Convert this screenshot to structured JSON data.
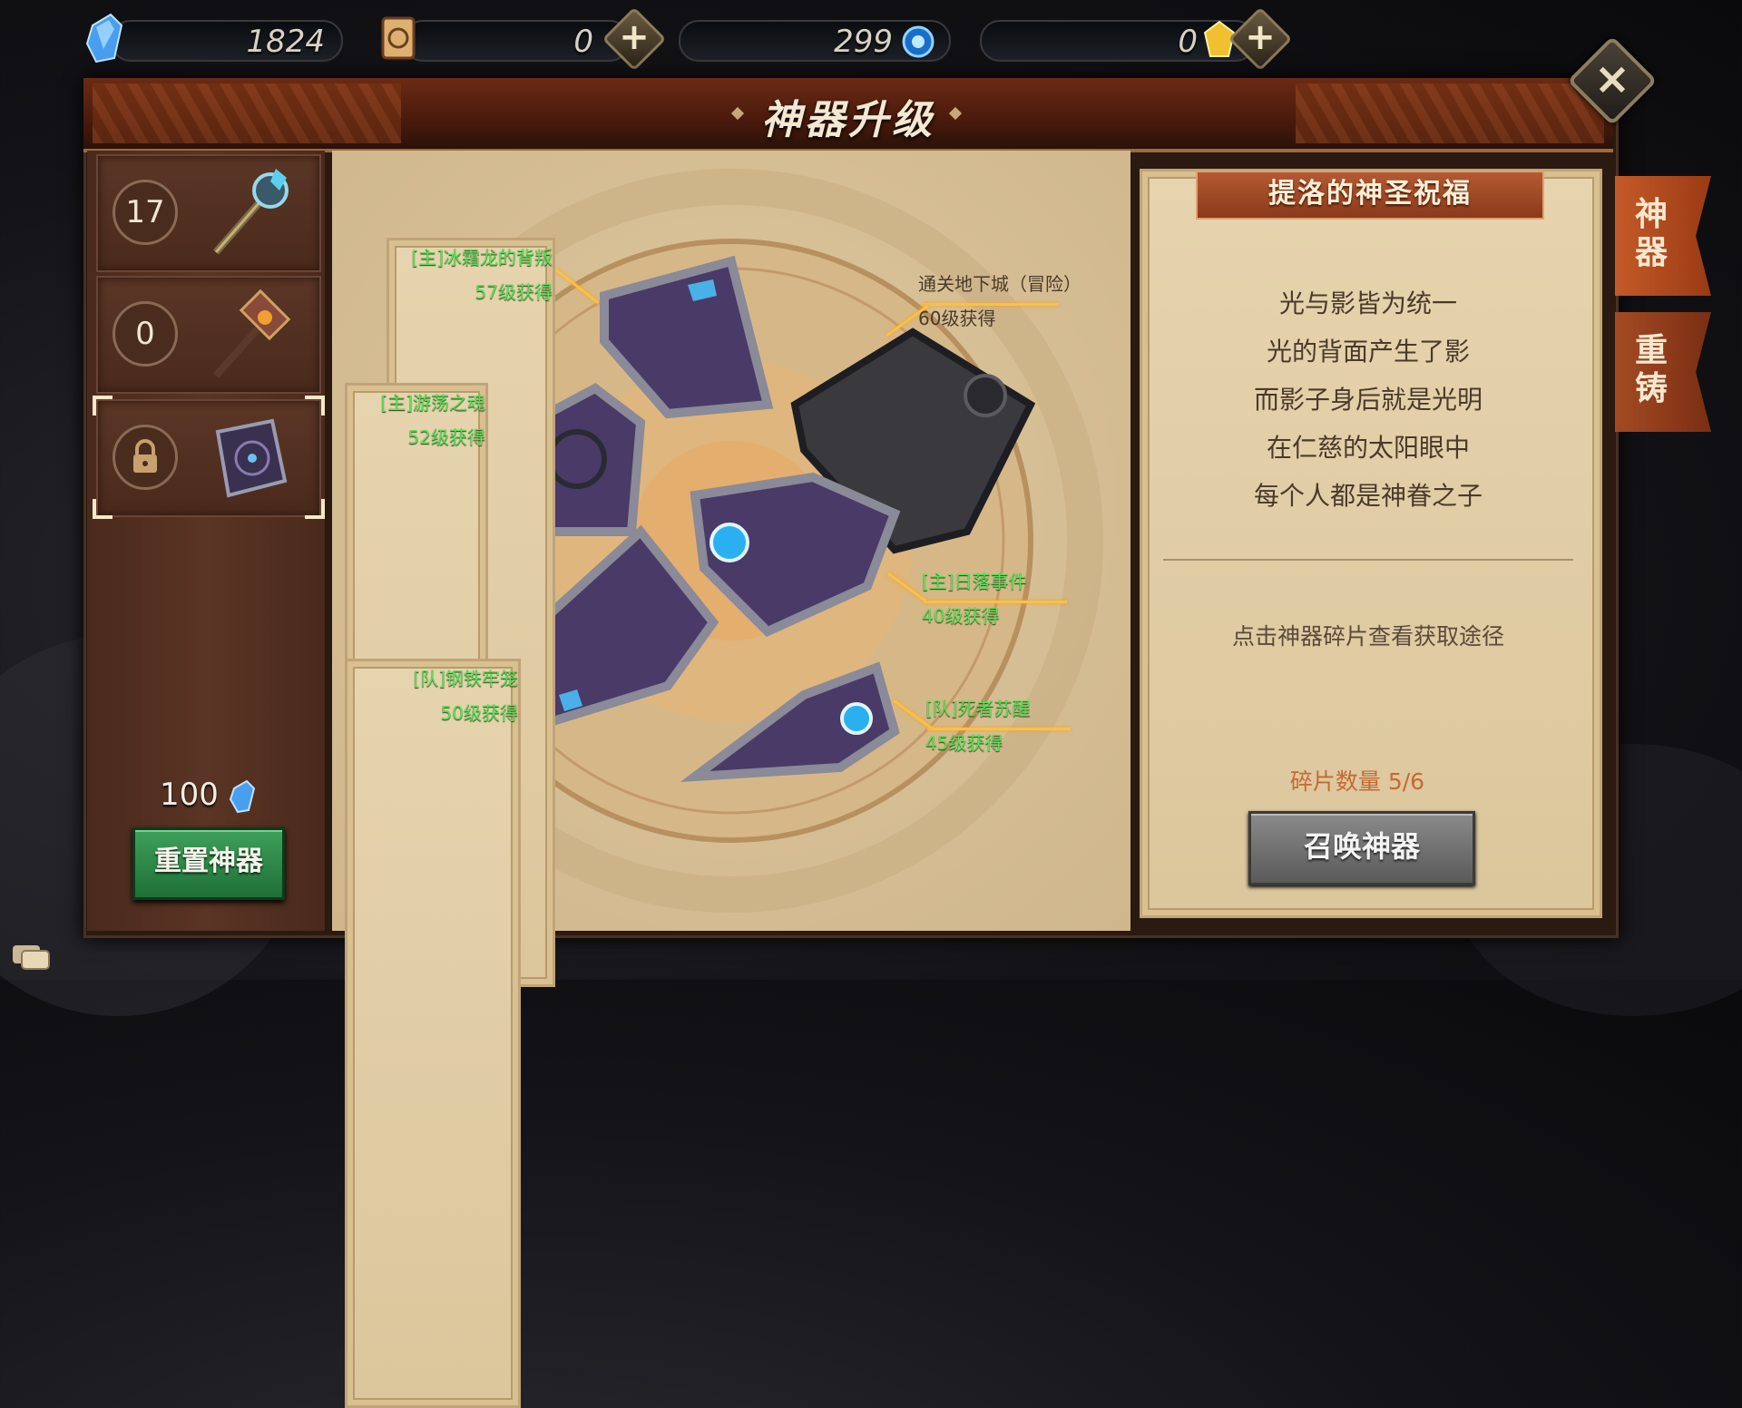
{
  "currencies": [
    {
      "name": "crystal",
      "value": "1824",
      "icon": "blue-crystal-icon"
    },
    {
      "name": "scroll",
      "value": "0",
      "icon": "scroll-icon"
    },
    {
      "name": "orb",
      "value": "299",
      "icon": "blue-orb-icon"
    },
    {
      "name": "gold",
      "value": "0",
      "icon": "gold-gem-icon"
    }
  ],
  "header": {
    "title": "神器升级"
  },
  "slots": [
    {
      "count": "17",
      "item": "scepter"
    },
    {
      "count": "0",
      "item": "hammer"
    },
    {
      "count": null,
      "item": "tome",
      "locked": true,
      "selected": true
    }
  ],
  "reset": {
    "cost": "100",
    "label": "重置神器"
  },
  "fragments": [
    {
      "source": "[主]冰霜龙的背叛",
      "level": "57级获得"
    },
    {
      "source": "[主]游荡之魂",
      "level": "52级获得"
    },
    {
      "source": "[队]钢铁牢笼",
      "level": "50级获得"
    },
    {
      "source": "通关地下城（冒险）",
      "level": "60级获得"
    },
    {
      "source": "[主]日落事件",
      "level": "40级获得"
    },
    {
      "source": "[队]死者苏醒",
      "level": "45级获得"
    }
  ],
  "blessing": {
    "title": "提洛的神圣祝福",
    "lines": [
      "光与影皆为统一",
      "光的背面产生了影",
      "而影子身后就是光明",
      "在仁慈的太阳眼中",
      "每个人都是神眷之子"
    ],
    "hint": "点击神器碎片查看获取途径",
    "fragment_count": "碎片数量 5/6",
    "summon_label": "召唤神器"
  },
  "side_tabs": [
    {
      "label": "神器",
      "active": true
    },
    {
      "label": "重铸",
      "active": false
    }
  ],
  "colors": {
    "accent_green": "#58e05a",
    "leader_line": "#f6c24a",
    "panel_brown": "#4a2a1c"
  }
}
